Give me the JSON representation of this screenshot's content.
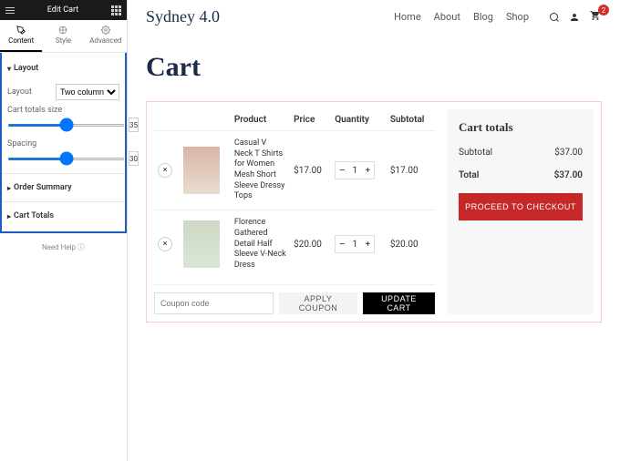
{
  "panel": {
    "title": "Edit Cart",
    "tabs": {
      "content": "Content",
      "style": "Style",
      "advanced": "Advanced"
    },
    "sections": {
      "layout": "Layout",
      "order_summary": "Order Summary",
      "cart_totals": "Cart Totals"
    },
    "layout": {
      "label": "Layout",
      "select": "Two columns",
      "size_label": "Cart totals size",
      "size_val": "35",
      "spacing_label": "Spacing",
      "spacing_val": "30"
    },
    "help": "Need Help"
  },
  "site": {
    "brand": "Sydney 4.0",
    "nav": [
      "Home",
      "About",
      "Blog",
      "Shop"
    ],
    "cart_badge": "2"
  },
  "page": {
    "title": "Cart"
  },
  "table": {
    "headers": {
      "product": "Product",
      "price": "Price",
      "qty": "Quantity",
      "subtotal": "Subtotal"
    },
    "items": [
      {
        "name": "Casual V Neck T Shirts for Women Mesh Short Sleeve Dressy Tops",
        "price": "$17.00",
        "qty": "1",
        "subtotal": "$17.00"
      },
      {
        "name": "Florence Gathered Detail Half Sleeve V-Neck Dress",
        "price": "$20.00",
        "qty": "1",
        "subtotal": "$20.00"
      }
    ]
  },
  "actions": {
    "coupon_placeholder": "Coupon code",
    "apply": "APPLY COUPON",
    "update": "UPDATE CART"
  },
  "totals": {
    "title": "Cart totals",
    "subtotal_label": "Subtotal",
    "subtotal_val": "$37.00",
    "total_label": "Total",
    "total_val": "$37.00",
    "checkout": "PROCEED TO CHECKOUT"
  }
}
